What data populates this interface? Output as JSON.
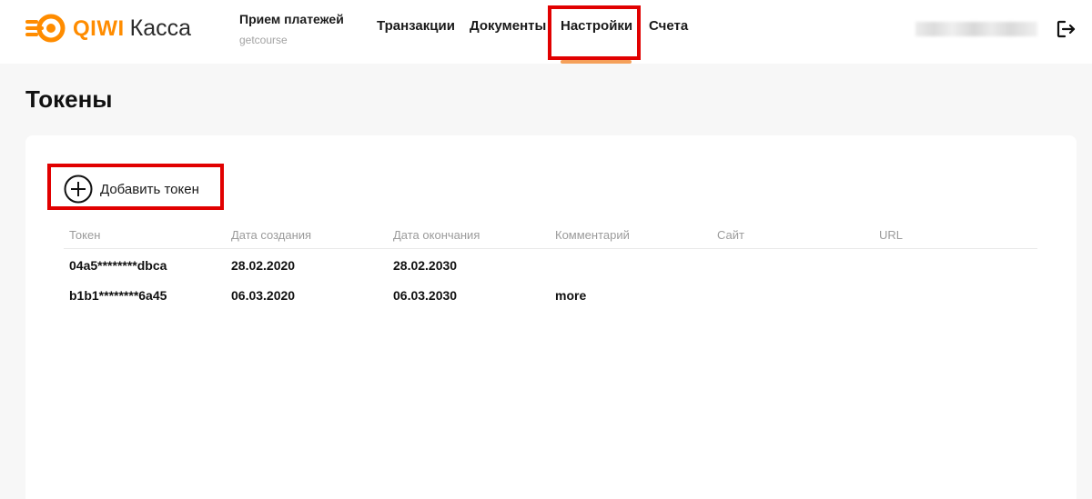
{
  "logo": {
    "brand": "QIWI",
    "product": "Касса"
  },
  "account": {
    "title": "Прием платежей",
    "subtitle": "getcourse"
  },
  "nav": {
    "items": [
      {
        "label": "Транзакции"
      },
      {
        "label": "Документы"
      },
      {
        "label": "Настройки",
        "active": true
      },
      {
        "label": "Счета"
      }
    ]
  },
  "icons": {
    "logo": "qiwi-logo-icon",
    "logout": "logout-icon",
    "add": "plus-circle-icon"
  },
  "colors": {
    "accent": "#ff8c00",
    "nav_underline": "#f5a05a",
    "highlight": "#e10000"
  },
  "page": {
    "title": "Токены"
  },
  "tokens": {
    "add_label": "Добавить токен",
    "columns": [
      "Токен",
      "Дата создания",
      "Дата окончания",
      "Комментарий",
      "Сайт",
      "URL"
    ],
    "rows": [
      [
        "04a5********dbca",
        "28.02.2020",
        "28.02.2030",
        "",
        "",
        ""
      ],
      [
        "b1b1********6a45",
        "06.03.2020",
        "06.03.2030",
        "more",
        "",
        ""
      ]
    ]
  }
}
